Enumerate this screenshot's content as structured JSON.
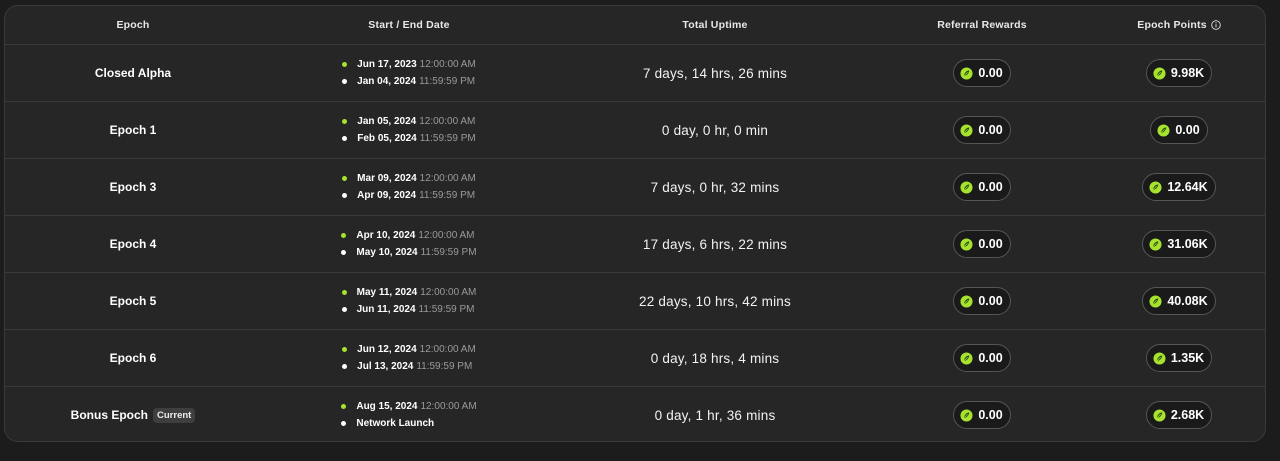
{
  "header": {
    "epoch": "Epoch",
    "dates": "Start / End Date",
    "uptime": "Total Uptime",
    "referral": "Referral Rewards",
    "points": "Epoch Points"
  },
  "rows": [
    {
      "name": "Closed Alpha",
      "start_date": "Jun 17, 2023",
      "start_time": "12:00:00 AM",
      "end_date": "Jan 04, 2024",
      "end_time": "11:59:59 PM",
      "uptime": "7 days, 14 hrs, 26 mins",
      "referral": "0.00",
      "points": "9.98K"
    },
    {
      "name": "Epoch 1",
      "start_date": "Jan 05, 2024",
      "start_time": "12:00:00 AM",
      "end_date": "Feb 05, 2024",
      "end_time": "11:59:59 PM",
      "uptime": "0 day, 0 hr, 0 min",
      "referral": "0.00",
      "points": "0.00"
    },
    {
      "name": "Epoch 3",
      "start_date": "Mar 09, 2024",
      "start_time": "12:00:00 AM",
      "end_date": "Apr 09, 2024",
      "end_time": "11:59:59 PM",
      "uptime": "7 days, 0 hr, 32 mins",
      "referral": "0.00",
      "points": "12.64K"
    },
    {
      "name": "Epoch 4",
      "start_date": "Apr 10, 2024",
      "start_time": "12:00:00 AM",
      "end_date": "May 10, 2024",
      "end_time": "11:59:59 PM",
      "uptime": "17 days, 6 hrs, 22 mins",
      "referral": "0.00",
      "points": "31.06K"
    },
    {
      "name": "Epoch 5",
      "start_date": "May 11, 2024",
      "start_time": "12:00:00 AM",
      "end_date": "Jun 11, 2024",
      "end_time": "11:59:59 PM",
      "uptime": "22 days, 10 hrs, 42 mins",
      "referral": "0.00",
      "points": "40.08K"
    },
    {
      "name": "Epoch 6",
      "start_date": "Jun 12, 2024",
      "start_time": "12:00:00 AM",
      "end_date": "Jul 13, 2024",
      "end_time": "11:59:59 PM",
      "uptime": "0 day, 18 hrs, 4 mins",
      "referral": "0.00",
      "points": "1.35K"
    },
    {
      "name": "Bonus Epoch",
      "badge": "Current",
      "start_date": "Aug 15, 2024",
      "start_time": "12:00:00 AM",
      "end_date": "Network Launch",
      "end_time": "",
      "uptime": "0 day, 1 hr, 36 mins",
      "referral": "0.00",
      "points": "2.68K"
    }
  ],
  "colors": {
    "accent_green": "#a6e22e",
    "background": "#262626",
    "border": "#3a3a3a"
  },
  "icons": {
    "coin": "green-coin-icon",
    "info": "info-icon",
    "start_dot": "green-dot-icon",
    "end_dot": "white-dot-icon"
  }
}
